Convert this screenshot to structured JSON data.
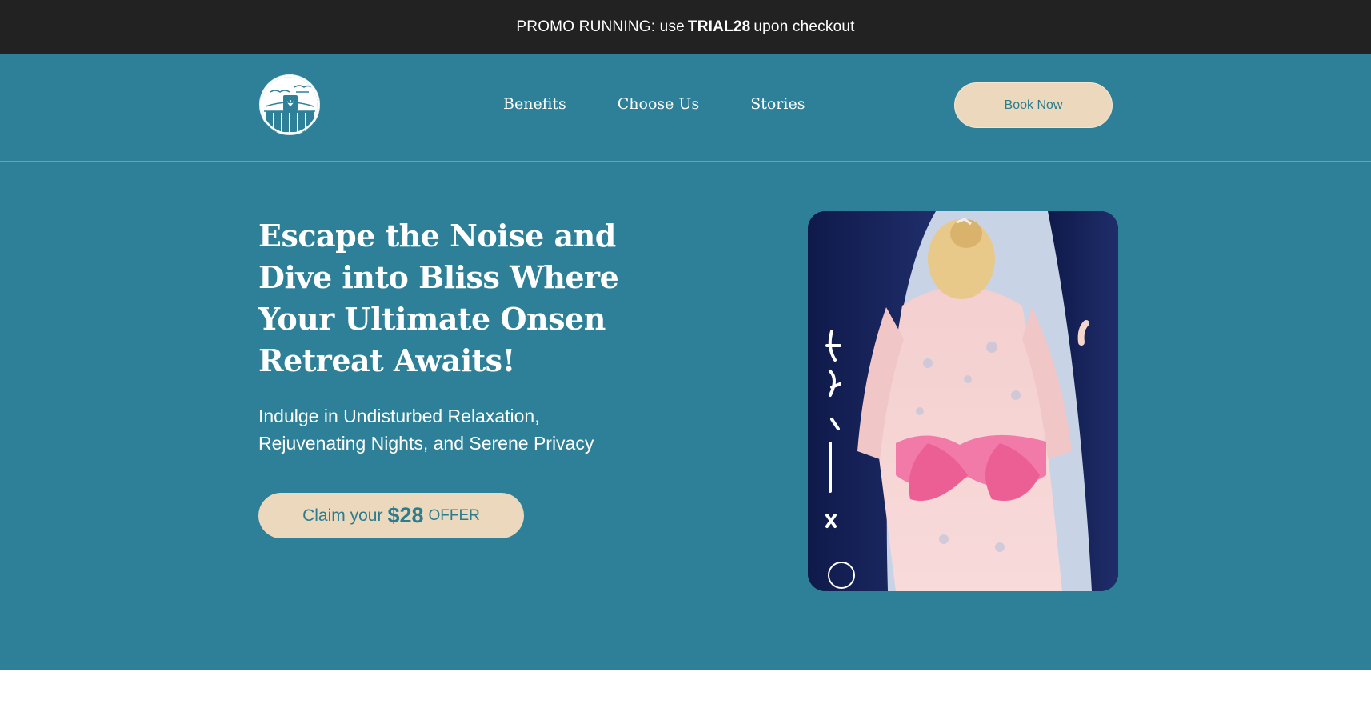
{
  "promo": {
    "prefix": "PROMO RUNNING: use",
    "code": "TRIAL28",
    "suffix": "upon checkout"
  },
  "header": {
    "logo_icon": "onsen-logo-icon",
    "nav": [
      {
        "label": "Benefits"
      },
      {
        "label": "Choose Us"
      },
      {
        "label": "Stories"
      }
    ],
    "book_label": "Book Now"
  },
  "hero": {
    "headline": "Escape the Noise and Dive into Bliss Where Your Ultimate Onsen Retreat Awaits!",
    "subheadline": "Indulge in Undisturbed Relaxation, Rejuvenating Nights, and Serene Privacy",
    "offer": {
      "prefix": "Claim your",
      "amount": "$28",
      "suffix": "OFFER"
    },
    "image_icon": "woman-in-kimono-photo",
    "curtain_text": "ルンパ ーザーシ イ"
  },
  "colors": {
    "promo_bg": "#222222",
    "hero_bg": "#2d8098",
    "button_bg": "#ecd8bd",
    "button_text": "#2a7c8f"
  }
}
